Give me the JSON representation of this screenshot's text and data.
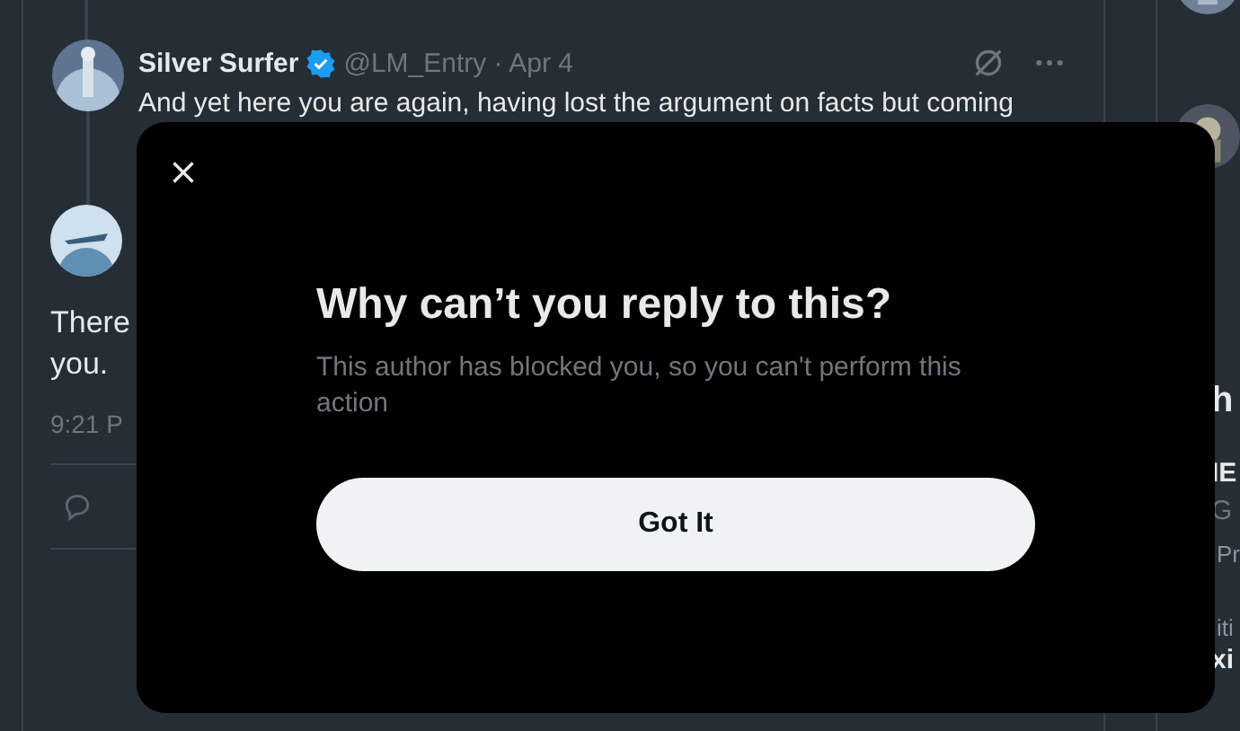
{
  "tweets": [
    {
      "name": "Silver Surfer",
      "verified": true,
      "handle": "@LM_Entry",
      "separator": "·",
      "date": "Apr 4",
      "text": "And yet here you are again, having lost the argument on facts but coming"
    }
  ],
  "reply": {
    "text_lines": [
      "There",
      "you."
    ],
    "time": "9:21 P"
  },
  "sidebar": {
    "heading": "h",
    "items": [
      {
        "kind": "bold",
        "text": "IE"
      },
      {
        "kind": "muted",
        "text": "G"
      },
      {
        "kind": "small",
        "text": "Pr"
      },
      {
        "kind": "small",
        "text": "iti"
      },
      {
        "kind": "bold",
        "text": "xi"
      }
    ]
  },
  "dialog": {
    "title": "Why can’t you reply to this?",
    "message": "This author has blocked you, so you can't perform this action",
    "button": "Got It"
  }
}
